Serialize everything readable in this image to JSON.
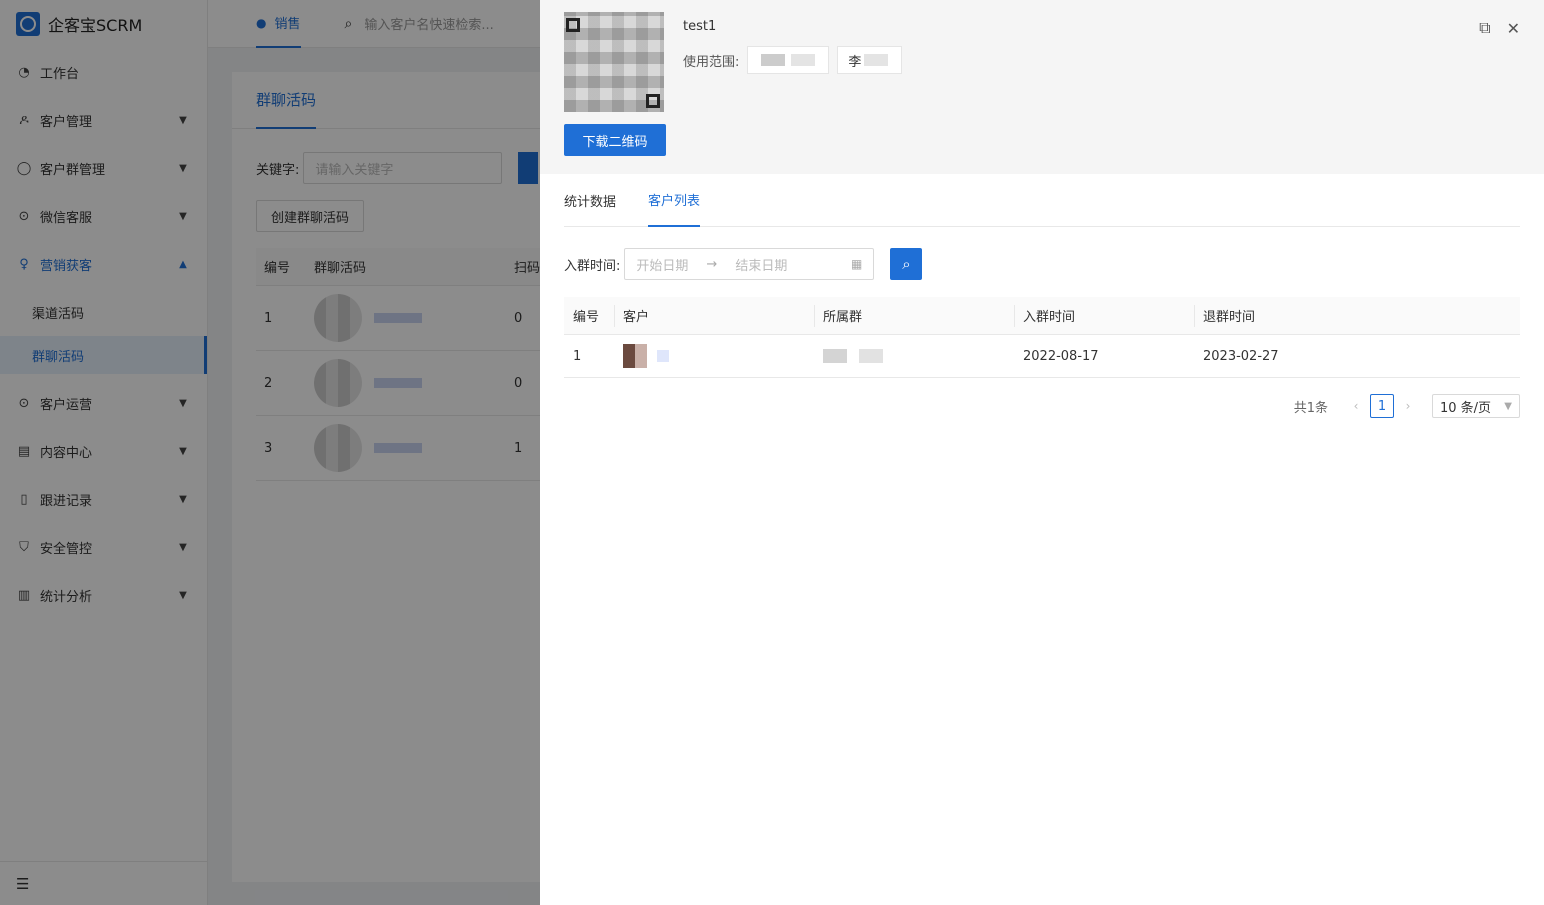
{
  "app": {
    "title": "企客宝SCRM"
  },
  "sidebar": {
    "items": [
      {
        "label": "工作台",
        "icon": "dashboard-icon"
      },
      {
        "label": "客户管理",
        "icon": "users-icon"
      },
      {
        "label": "客户群管理",
        "icon": "chat-group-icon"
      },
      {
        "label": "微信客服",
        "icon": "service-icon"
      },
      {
        "label": "营销获客",
        "icon": "bulb-icon"
      },
      {
        "label": "客户运营",
        "icon": "operations-icon"
      },
      {
        "label": "内容中心",
        "icon": "content-icon"
      },
      {
        "label": "跟进记录",
        "icon": "record-icon"
      },
      {
        "label": "安全管控",
        "icon": "shield-icon"
      },
      {
        "label": "统计分析",
        "icon": "bar-chart-icon"
      }
    ],
    "submenu": [
      {
        "label": "渠道活码"
      },
      {
        "label": "群聊活码"
      }
    ]
  },
  "topbar": {
    "tab_label": "销售",
    "search_placeholder": "输入客户名快速检索..."
  },
  "content": {
    "tab_label": "群聊活码",
    "filter_label": "关键字:",
    "filter_placeholder": "请输入关键字",
    "create_button": "创建群聊活码",
    "table": {
      "columns": [
        "编号",
        "群聊活码",
        "扫码"
      ],
      "rows": [
        {
          "no": "1",
          "scans": "0"
        },
        {
          "no": "2",
          "scans": "0"
        },
        {
          "no": "3",
          "scans": "1"
        }
      ]
    }
  },
  "drawer": {
    "title": "test1",
    "scope_label": "使用范围:",
    "scope_tag2_char": "李",
    "download_button": "下载二维码",
    "tabs": [
      "统计数据",
      "客户列表"
    ],
    "date_label": "入群时间:",
    "start_placeholder": "开始日期",
    "end_placeholder": "结束日期",
    "table": {
      "columns": [
        "编号",
        "客户",
        "所属群",
        "入群时间",
        "退群时间"
      ],
      "rows": [
        {
          "no": "1",
          "join_time": "2022-08-17",
          "leave_time": "2023-02-27"
        }
      ]
    },
    "pagination": {
      "total": "共1条",
      "current_page": "1",
      "page_size": "10 条/页"
    }
  },
  "colors": {
    "accent": "#1f6fd6"
  }
}
